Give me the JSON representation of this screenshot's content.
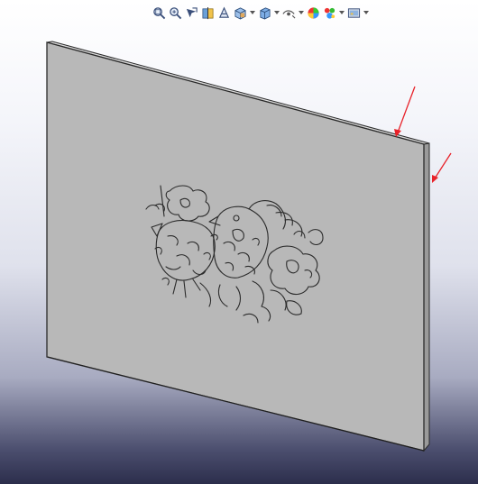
{
  "toolbar": {
    "tools": [
      {
        "icon": "zoom-to-fit-icon",
        "dropdown": false
      },
      {
        "icon": "zoom-to-area-icon",
        "dropdown": false
      },
      {
        "icon": "previous-view-icon",
        "dropdown": false
      },
      {
        "icon": "section-view-icon",
        "dropdown": false
      },
      {
        "icon": "dynamic-annotation-views-icon",
        "dropdown": false
      },
      {
        "icon": "view-orientation-icon",
        "dropdown": true
      },
      {
        "icon": "display-style-icon",
        "dropdown": true
      },
      {
        "icon": "hide-show-items-icon",
        "dropdown": true
      },
      {
        "icon": "edit-appearance-icon",
        "dropdown": false
      },
      {
        "icon": "apply-scene-icon",
        "dropdown": true
      },
      {
        "icon": "view-settings-icon",
        "dropdown": true
      }
    ]
  },
  "viewport": {
    "model": "thin-plate-with-engraved-bird-pattern",
    "plate_color": "#b8b8b8",
    "edge_color": "#2a2a2a",
    "annotation_arrow_color": "#e8222a",
    "annotation_arrow_count": 2
  }
}
